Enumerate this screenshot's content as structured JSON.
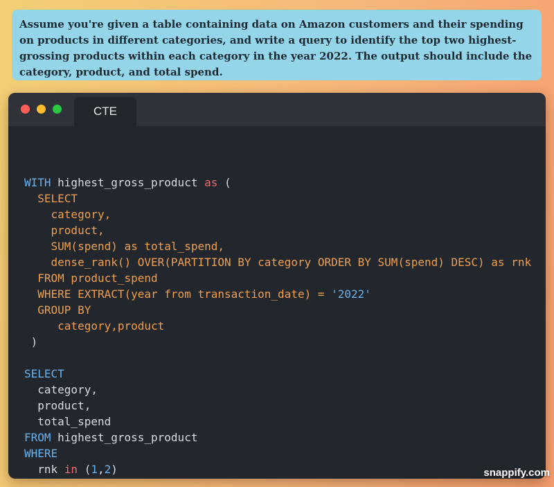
{
  "question": {
    "text": "Assume you're given a table containing data on Amazon customers and their spending on products in different categories, and write a query to identify the top two highest-grossing products within each category in the year 2022. The output should include the category, product, and total spend."
  },
  "window": {
    "tab_label": "CTE"
  },
  "colors": {
    "keyword": "#69b2ee",
    "clause": "#ee9f4f",
    "operator": "#ef6b6b",
    "string": "#69b2ee",
    "number": "#69b2ee",
    "plain": "#d8dce2"
  },
  "code": {
    "lines": [
      [],
      [
        {
          "t": "WITH",
          "c": "keyword"
        },
        {
          "t": " highest_gross_product ",
          "c": "plain"
        },
        {
          "t": "as",
          "c": "operator"
        },
        {
          "t": " (",
          "c": "plain"
        }
      ],
      [
        {
          "t": "  SELECT",
          "c": "clause"
        }
      ],
      [
        {
          "t": "    category,",
          "c": "clause"
        }
      ],
      [
        {
          "t": "    product,",
          "c": "clause"
        }
      ],
      [
        {
          "t": "    SUM(spend) as total_spend,",
          "c": "clause"
        }
      ],
      [
        {
          "t": "    dense_rank() OVER(PARTITION BY category ORDER BY SUM(spend) DESC) as rnk",
          "c": "clause"
        }
      ],
      [
        {
          "t": "  FROM product_spend",
          "c": "clause"
        }
      ],
      [
        {
          "t": "  WHERE EXTRACT(year from transaction_date) = ",
          "c": "clause"
        },
        {
          "t": "'2022'",
          "c": "string"
        }
      ],
      [
        {
          "t": "  GROUP BY",
          "c": "clause"
        }
      ],
      [
        {
          "t": "     category,product",
          "c": "clause"
        }
      ],
      [
        {
          "t": " )",
          "c": "plain"
        }
      ],
      [],
      [
        {
          "t": "SELECT",
          "c": "keyword"
        }
      ],
      [
        {
          "t": "  category,",
          "c": "plain"
        }
      ],
      [
        {
          "t": "  product,",
          "c": "plain"
        }
      ],
      [
        {
          "t": "  total_spend",
          "c": "plain"
        }
      ],
      [
        {
          "t": "FROM",
          "c": "keyword"
        },
        {
          "t": " highest_gross_product",
          "c": "plain"
        }
      ],
      [
        {
          "t": "WHERE",
          "c": "keyword"
        }
      ],
      [
        {
          "t": "  rnk ",
          "c": "plain"
        },
        {
          "t": "in",
          "c": "operator"
        },
        {
          "t": " (",
          "c": "plain"
        },
        {
          "t": "1",
          "c": "number"
        },
        {
          "t": ",",
          "c": "plain"
        },
        {
          "t": "2",
          "c": "number"
        },
        {
          "t": ")",
          "c": "plain"
        }
      ]
    ]
  },
  "watermark": {
    "text": "snappify.com"
  }
}
